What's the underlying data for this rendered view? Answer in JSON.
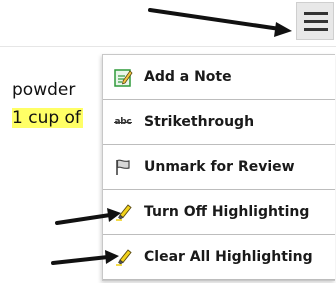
{
  "menu_items": [
    {
      "label": "Add a Note",
      "icon": "note-pencil-icon"
    },
    {
      "label": "Strikethrough",
      "icon": "strikethrough-icon",
      "icon_text": "abc"
    },
    {
      "label": "Unmark for Review",
      "icon": "flag-icon"
    },
    {
      "label": "Turn Off Highlighting",
      "icon": "highlighter-icon"
    },
    {
      "label": "Clear All Highlighting",
      "icon": "highlighter-icon"
    }
  ],
  "document": {
    "line1": "powder",
    "line2": "1 cup of"
  },
  "colors": {
    "highlight": "#ffff66",
    "arrow": "#111111",
    "note_icon": "#2e9a3a",
    "highlighter": "#f2d21b"
  },
  "toolbar": {
    "menu_icon": "hamburger-menu-icon"
  }
}
